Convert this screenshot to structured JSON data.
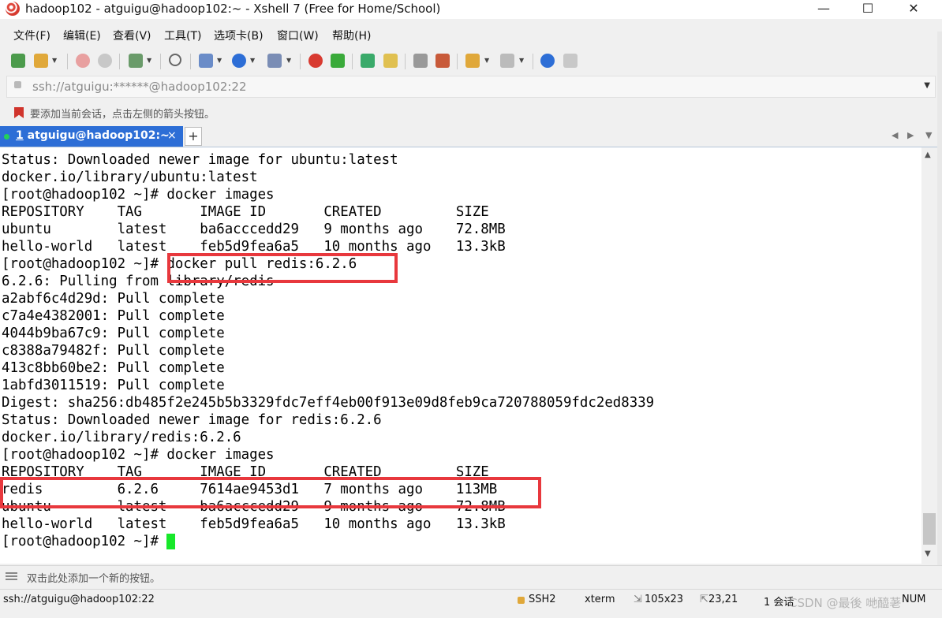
{
  "window": {
    "title": "hadoop102 - atguigu@hadoop102:~ - Xshell 7 (Free for Home/School)",
    "minimize": "—",
    "maximize": "☐",
    "close": "✕"
  },
  "menu": [
    "文件(F)",
    "编辑(E)",
    "查看(V)",
    "工具(T)",
    "选项卡(B)",
    "窗口(W)",
    "帮助(H)"
  ],
  "address": {
    "value": "ssh://atguigu:******@hadoop102:22"
  },
  "hint": "要添加当前会话，点击左侧的箭头按钮。",
  "tabs": [
    {
      "number": "1",
      "label": "atguigu@hadoop102:~",
      "close": "×"
    }
  ],
  "tab_add": "+",
  "terminal": {
    "lines": [
      "Status: Downloaded newer image for ubuntu:latest",
      "docker.io/library/ubuntu:latest",
      "[root@hadoop102 ~]# docker images",
      "REPOSITORY    TAG       IMAGE ID       CREATED         SIZE",
      "ubuntu        latest    ba6acccedd29   9 months ago    72.8MB",
      "hello-world   latest    feb5d9fea6a5   10 months ago   13.3kB",
      "[root@hadoop102 ~]# docker pull redis:6.2.6",
      "6.2.6: Pulling from library/redis",
      "a2abf6c4d29d: Pull complete",
      "c7a4e4382001: Pull complete",
      "4044b9ba67c9: Pull complete",
      "c8388a79482f: Pull complete",
      "413c8bb60be2: Pull complete",
      "1abfd3011519: Pull complete",
      "Digest: sha256:db485f2e245b5b3329fdc7eff4eb00f913e09d8feb9ca720788059fdc2ed8339",
      "Status: Downloaded newer image for redis:6.2.6",
      "docker.io/library/redis:6.2.6",
      "[root@hadoop102 ~]# docker images",
      "REPOSITORY    TAG       IMAGE ID       CREATED         SIZE",
      "redis         6.2.6     7614ae9453d1   7 months ago    113MB",
      "ubuntu        latest    ba6acccedd29   9 months ago    72.8MB",
      "hello-world   latest    feb5d9fea6a5   10 months ago   13.3kB"
    ],
    "prompt": "[root@hadoop102 ~]# ",
    "highlight_color": "#e8383d",
    "cursor_color": "#17e82a"
  },
  "quickbar": {
    "text": "双击此处添加一个新的按钮。"
  },
  "status": {
    "connection": "ssh://atguigu@hadoop102:22",
    "protocol": "SSH2",
    "terminal_type": "xterm",
    "size": "105x23",
    "cursor_pos": "23,21",
    "sessions": "1 会话",
    "num": "NUM"
  },
  "watermark": "CSDN @最後 哋醯荖"
}
